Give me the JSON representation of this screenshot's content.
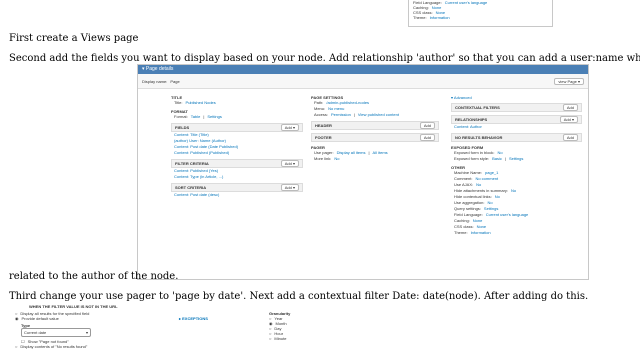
{
  "top_fragment": {
    "rows": [
      {
        "label": "Field Language:",
        "value": "Current user's language"
      },
      {
        "label": "Caching:",
        "value": "None"
      },
      {
        "label": "CSS class:",
        "value": "None"
      },
      {
        "label": "Theme:",
        "value": "Information"
      }
    ]
  },
  "steps": {
    "step1": "First create a Views page",
    "step2": "Second add the fields you want to display based on your node. Add relationship 'author' so that you can add a user:name which is",
    "step2_cont": "related to the author of the node.",
    "step3": "Third change your use pager to 'page by date'. Next add a contextual filter Date: date(node). After adding do this."
  },
  "views_ui": {
    "page_details_label": "Page details",
    "display_name_label": "Display name:",
    "display_name_value": "Page",
    "view_page_button": "view Page",
    "title_section": "TITLE",
    "title_row": {
      "label": "Title:",
      "value": "Published Nodes"
    },
    "format_section": "FORMAT",
    "format_row": {
      "label": "Format:",
      "value": "Table",
      "sep": "|",
      "settings": "Settings"
    },
    "fields_section": "FIELDS",
    "fields": [
      "Content: Title (Title)",
      "(author) User: Name (Author)",
      "Content: Post date (Date Published)",
      "Content: Published (Published)"
    ],
    "filter_section": "FILTER CRITERIA",
    "filters": [
      "Content: Published (Yes)",
      "Content: Type (in Article, ...)"
    ],
    "sort_section": "SORT CRITERIA",
    "sorts": [
      "Content: Post date (desc)"
    ],
    "add_label": "Add",
    "page_settings_section": "PAGE SETTINGS",
    "path_row": {
      "label": "Path:",
      "value": "/admin-published-nodes"
    },
    "menu_row": {
      "label": "Menu:",
      "value": "No menu"
    },
    "access_row": {
      "label": "Access:",
      "value": "Permission",
      "sep": "|",
      "extra": "View published content"
    },
    "header_section": "HEADER",
    "footer_section": "FOOTER",
    "pager_section": "PAGER",
    "use_pager_row": {
      "label": "Use pager:",
      "value": "Display all items",
      "sep": "|",
      "extra": "All items"
    },
    "more_link_row": {
      "label": "More link:",
      "value": "No"
    },
    "advanced_label": "Advanced",
    "contextual_filters_section": "CONTEXTUAL FILTERS",
    "relationships_section": "RELATIONSHIPS",
    "relationship_item": "Content: Author",
    "no_results_section": "NO RESULTS BEHAVIOR",
    "exposed_form_section": "EXPOSED FORM",
    "exposed_rows": [
      {
        "label": "Exposed form in block:",
        "value": "No"
      },
      {
        "label": "Exposed form style:",
        "value": "Basic",
        "sep": "|",
        "extra": "Settings"
      }
    ],
    "other_section": "OTHER",
    "other_rows": [
      {
        "label": "Machine Name:",
        "value": "page_1"
      },
      {
        "label": "Comment:",
        "value": "No comment"
      },
      {
        "label": "Use AJAX:",
        "value": "No"
      },
      {
        "label": "Hide attachments in summary:",
        "value": "No"
      },
      {
        "label": "Hide contextual links:",
        "value": "No"
      },
      {
        "label": "Use aggregation:",
        "value": "No"
      },
      {
        "label": "Query settings:",
        "value": "Settings"
      },
      {
        "label": "Field Language:",
        "value": "Current user's language"
      },
      {
        "label": "Caching:",
        "value": "None"
      },
      {
        "label": "CSS class:",
        "value": "None"
      },
      {
        "label": "Theme:",
        "value": "Information"
      }
    ]
  },
  "bottom_fragment": {
    "filter_missing_heading": "WHEN THE FILTER VALUE IS NOT IN THE URL",
    "radio_display_all": "Display all results for the specified field",
    "radio_provide_default": "Provide default value",
    "type_label": "Type",
    "type_value": "Current date",
    "checkbox_show_not_found": "Show \"Page not found\"",
    "checkbox_display_contents": "Display contents of \"No results found\"",
    "exceptions_label": "EXCEPTIONS",
    "granularity_label": "Granularity",
    "granularity_options": [
      "Year",
      "Month",
      "Day",
      "Hour",
      "Minute"
    ],
    "granularity_selected": "Month"
  }
}
